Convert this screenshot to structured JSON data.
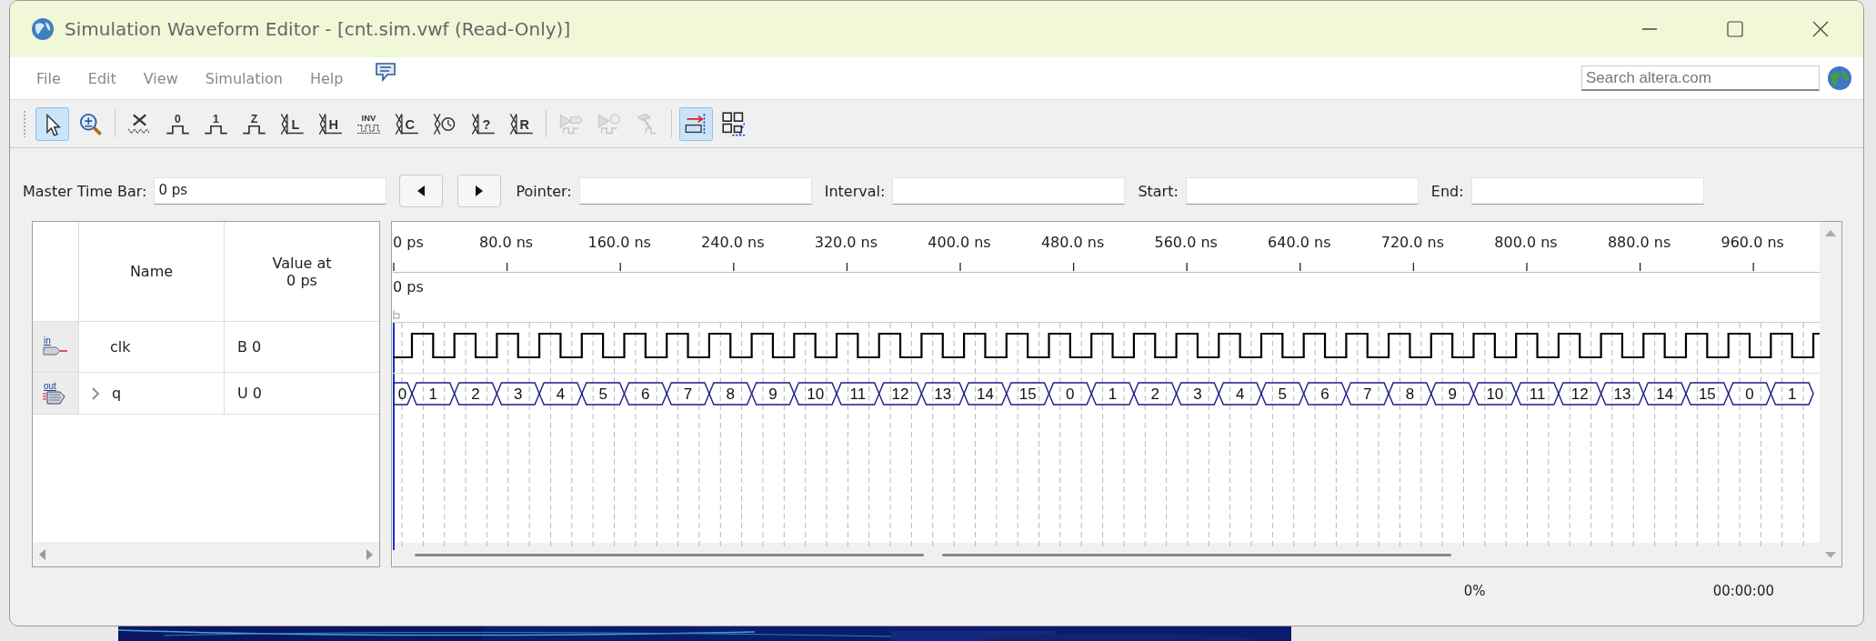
{
  "window": {
    "title": "Simulation Waveform Editor - [cnt.sim.vwf (Read-Only)]"
  },
  "menu": [
    "File",
    "Edit",
    "View",
    "Simulation",
    "Help"
  ],
  "search": {
    "placeholder": "Search altera.com"
  },
  "toolbar": [
    [
      {
        "kind": "select",
        "selected": true,
        "disabled": false
      },
      {
        "kind": "zoom",
        "selected": false,
        "disabled": false
      }
    ],
    [
      {
        "kind": "unknown",
        "selected": false,
        "disabled": false
      },
      {
        "kind": "level",
        "glyph": "0",
        "selected": false,
        "disabled": false
      },
      {
        "kind": "level",
        "glyph": "1",
        "selected": false,
        "disabled": false
      },
      {
        "kind": "level",
        "glyph": "Z",
        "selected": false,
        "disabled": false
      },
      {
        "kind": "bus",
        "glyph": "L",
        "selected": false,
        "disabled": false
      },
      {
        "kind": "bus",
        "glyph": "H",
        "selected": false,
        "disabled": false
      },
      {
        "kind": "invert",
        "glyph": "INV",
        "selected": false,
        "disabled": false
      },
      {
        "kind": "bus",
        "glyph": "C",
        "selected": false,
        "disabled": false
      },
      {
        "kind": "count",
        "selected": false,
        "disabled": false
      },
      {
        "kind": "bus",
        "glyph": "?",
        "selected": false,
        "disabled": false
      },
      {
        "kind": "bus",
        "glyph": "R",
        "selected": false,
        "disabled": false
      }
    ],
    [
      {
        "kind": "run",
        "selected": false,
        "disabled": true
      },
      {
        "kind": "run-timing",
        "selected": false,
        "disabled": true
      },
      {
        "kind": "hammer",
        "selected": false,
        "disabled": true
      }
    ],
    [
      {
        "kind": "snap",
        "selected": true,
        "disabled": false
      },
      {
        "kind": "grid",
        "selected": false,
        "disabled": false
      }
    ]
  ],
  "time_bar": {
    "master_label": "Master Time Bar:",
    "master_value": "0 ps",
    "fields": [
      {
        "label": "Pointer:"
      },
      {
        "label": "Interval:"
      },
      {
        "label": "Start:"
      },
      {
        "label": "End:"
      }
    ]
  },
  "table": {
    "columns": [
      "Name",
      "Value at 0 ps"
    ]
  },
  "timeline": {
    "labels": [
      "0 ps",
      "80.0 ns",
      "160.0 ns",
      "240.0 ns",
      "320.0 ns",
      "400.0 ns",
      "480.0 ns",
      "560.0 ns",
      "640.0 ns",
      "720.0 ns",
      "800.0 ns",
      "880.0 ns",
      "960.0 ns"
    ],
    "cursor": "0 ps"
  },
  "signals": [
    {
      "kind": "input",
      "pin_label": "in",
      "name": "clk",
      "value": "B 0",
      "waveform": {
        "kind": "clock"
      }
    },
    {
      "kind": "output",
      "pin_label": "out",
      "name": "q",
      "value": "U 0",
      "expanded": false,
      "waveform": {
        "kind": "bus",
        "values": [
          "0",
          "1",
          "2",
          "3",
          "4",
          "5",
          "6",
          "7",
          "8",
          "9",
          "10",
          "11",
          "12",
          "13",
          "14",
          "15",
          "0",
          "1",
          "2",
          "3",
          "4",
          "5",
          "6",
          "7",
          "8",
          "9",
          "10",
          "11",
          "12",
          "13",
          "14",
          "15",
          "0",
          "1"
        ]
      }
    }
  ],
  "status": {
    "progress": "0%",
    "elapsed": "00:00:00"
  }
}
